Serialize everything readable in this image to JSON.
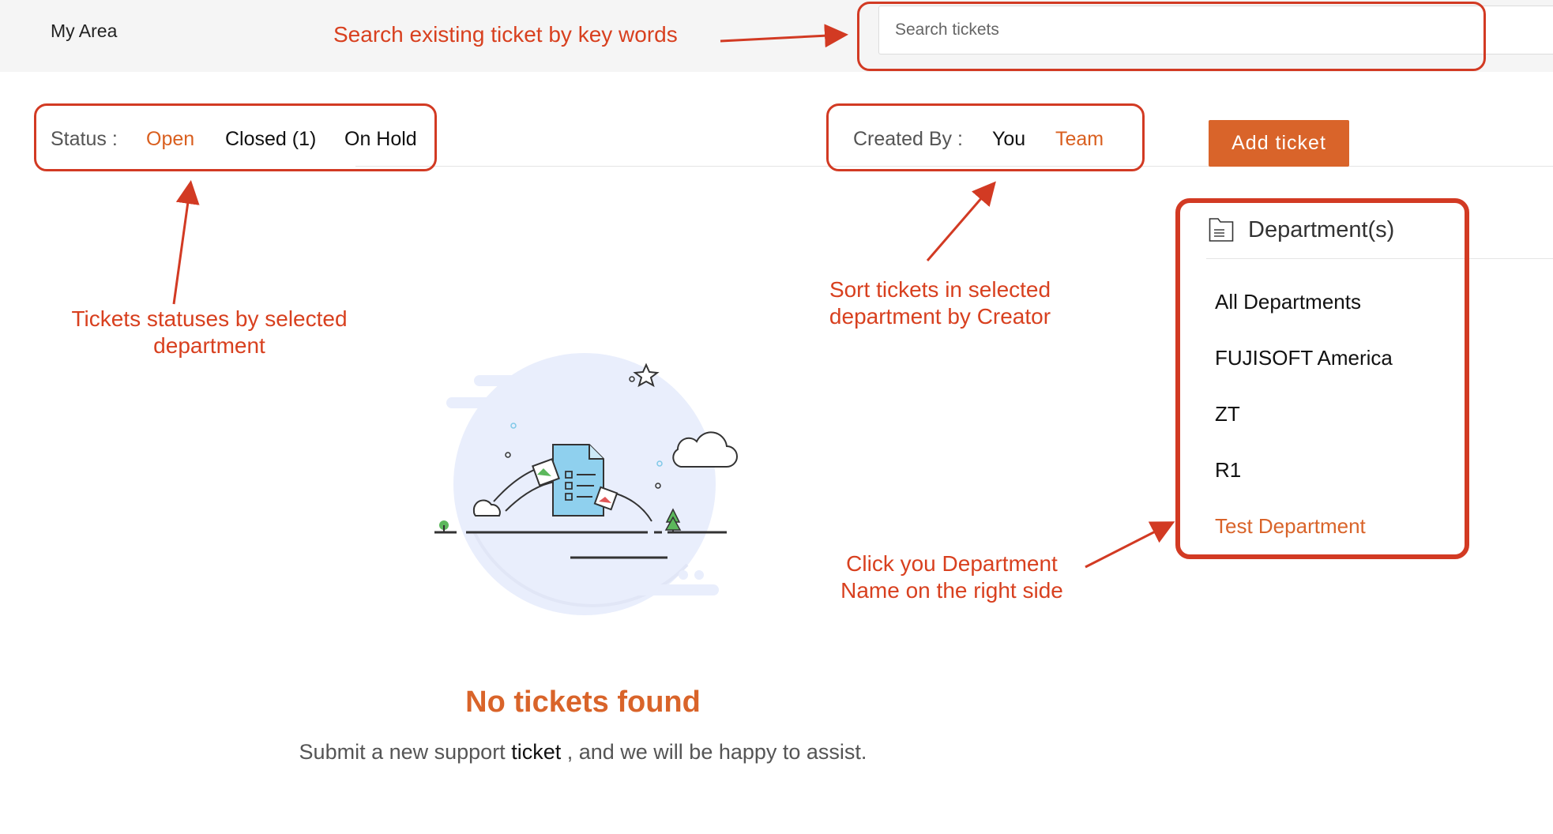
{
  "header": {
    "area_label": "My Area",
    "search_placeholder": "Search tickets"
  },
  "status_filter": {
    "label": "Status :",
    "options": [
      "Open",
      "Closed (1)",
      "On Hold"
    ],
    "selected": "Open"
  },
  "creator_filter": {
    "label": "Created By :",
    "options": [
      "You",
      "Team"
    ],
    "selected": "Team"
  },
  "add_ticket_label": "Add ticket",
  "departments": {
    "title": "Department(s)",
    "items": [
      "All Departments",
      "FUJISOFT America",
      "ZT",
      "R1",
      "Test Department"
    ],
    "selected": "Test Department"
  },
  "empty_state": {
    "title": "No tickets found",
    "subtitle_before": "Submit a new support ",
    "subtitle_keyword": "ticket",
    "subtitle_after": " , and we will be happy to assist."
  },
  "annotations": {
    "search": "Search existing ticket by key words",
    "status_line1": "Tickets statuses by selected",
    "status_line2": "department",
    "creator_line1": "Sort tickets in selected",
    "creator_line2": "department by Creator",
    "department_line1": "Click you Department",
    "department_line2": "Name on the right side"
  },
  "colors": {
    "accent": "#d9642a",
    "annotation_red": "#d23a23",
    "annotation_text": "#d8401f"
  }
}
